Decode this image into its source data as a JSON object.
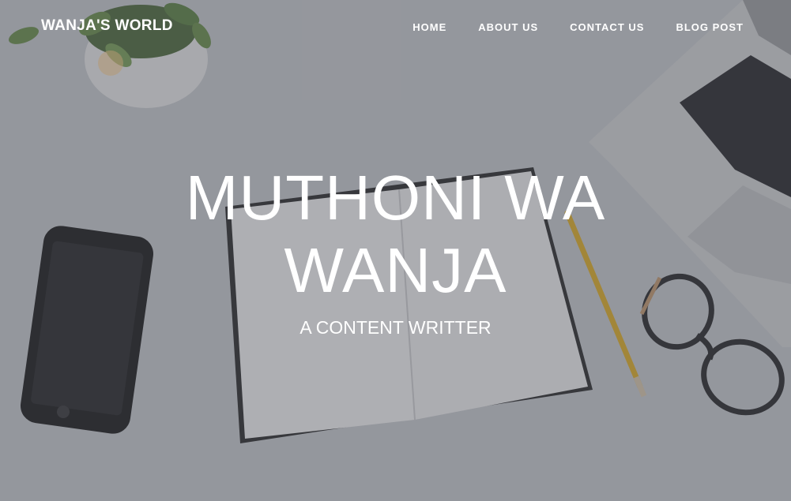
{
  "brand": {
    "name": "WANJA'S WORLD"
  },
  "nav": {
    "items": [
      {
        "label": "HOME"
      },
      {
        "label": "ABOUT US"
      },
      {
        "label": "CONTACT US"
      },
      {
        "label": "BLOG POST"
      }
    ]
  },
  "hero": {
    "title_line1": "MUTHONI WA",
    "title_line2": "WANJA",
    "subtitle": "A CONTENT WRITTER"
  },
  "colors": {
    "text": "#ffffff",
    "overlay": "rgba(70,72,80,0.40)",
    "desk": "#c9cbd0"
  }
}
